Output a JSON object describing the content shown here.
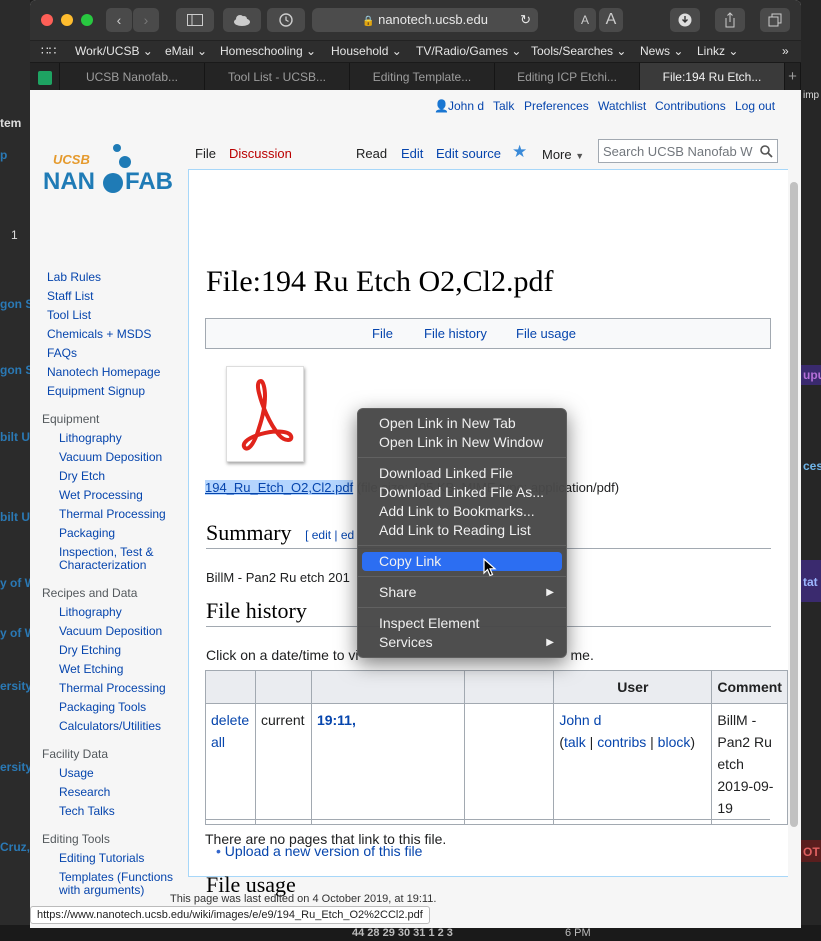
{
  "browser": {
    "url": "nanotech.ucsb.edu",
    "bookmarks": [
      "Work/UCSB",
      "eMail",
      "Homeschooling",
      "Household",
      "TV/Radio/Games",
      "Tools/Searches",
      "News",
      "Linkz"
    ],
    "tabs": [
      "UCSB Nanofab...",
      "Tool List - UCSB...",
      "Editing Template...",
      "Editing ICP Etchi...",
      "File:194 Ru Etch..."
    ],
    "status_url": "https://www.nanotech.ucsb.edu/wiki/images/e/e9/194_Ru_Etch_O2%2CCl2.pdf"
  },
  "background": {
    "left": [
      "tem",
      "p",
      "1",
      "gon S",
      "gon S",
      "bilt U",
      "bilt U",
      "y of W",
      "y of W",
      "ersity",
      "ersity",
      "Cruz,"
    ],
    "right": [
      "imp",
      "upu",
      "ces",
      "tat",
      "OT"
    ],
    "bottom_text": "44 28 29 30 31 1 2 3",
    "bottom_time": "6 PM"
  },
  "wiki": {
    "logo_top": "UCSB",
    "logo_main_1": "NAN",
    "logo_main_2": "FAB",
    "personal": {
      "user": "John d",
      "talk": "Talk",
      "preferences": "Preferences",
      "watchlist": "Watchlist",
      "contributions": "Contributions",
      "logout": "Log out"
    },
    "sidebar": {
      "main": [
        "Lab Rules",
        "Staff List",
        "Tool List",
        "Chemicals + MSDS",
        "FAQs",
        "Nanotech Homepage",
        "Equipment Signup"
      ],
      "equipment_head": "Equipment",
      "equipment": [
        "Lithography",
        "Vacuum Deposition",
        "Dry Etch",
        "Wet Processing",
        "Thermal Processing",
        "Packaging",
        "Inspection, Test & Characterization"
      ],
      "recipes_head": "Recipes and Data",
      "recipes": [
        "Lithography",
        "Vacuum Deposition",
        "Dry Etching",
        "Wet Etching",
        "Thermal Processing",
        "Packaging Tools",
        "Calculators/Utilities"
      ],
      "facility_head": "Facility Data",
      "facility": [
        "Usage",
        "Research",
        "Tech Talks"
      ],
      "editing_head": "Editing Tools",
      "editing": [
        "Editing Tutorials",
        "Templates (Functions with arguments)"
      ]
    },
    "tabs": {
      "file": "File",
      "discussion": "Discussion",
      "read": "Read",
      "edit": "Edit",
      "edit_source": "Edit source",
      "more": "More",
      "search_placeholder": "Search UCSB Nanofab W"
    },
    "title": "File:194 Ru Etch O2,Cl2.pdf",
    "filetoc": [
      "File",
      "File history",
      "File usage"
    ],
    "file_link": "194_Ru_Etch_O2,Cl2.pdf",
    "file_info": "(file size: 405 KB, MIME type: application/pdf)",
    "summary_heading": "Summary",
    "edit_bracket": "[ edit | ed",
    "summary_text": "BillM - Pan2 Ru etch 201",
    "history_heading": "File history",
    "history_intro_a": "Click on a date/time to vi",
    "history_intro_b": "me.",
    "history_table": {
      "headers": [
        "",
        "",
        "",
        "",
        "User",
        "Comment"
      ],
      "row": {
        "action_1": "delete",
        "action_2": "all",
        "status": "current",
        "datetime": "19:11,",
        "user": "John d",
        "talk": "talk",
        "contribs": "contribs",
        "block": "block",
        "comment_lines": [
          "BillM -",
          "Pan2 Ru",
          "etch",
          "2019-09-",
          "19"
        ]
      }
    },
    "upload_link": "Upload a new version of this file",
    "usage_heading": "File usage",
    "usage_text": "There are no pages that link to this file.",
    "footer": "This page was last edited on 4 October 2019, at 19:11."
  },
  "context_menu": {
    "items": [
      {
        "label": "Open Link in New Tab"
      },
      {
        "label": "Open Link in New Window"
      },
      {
        "label": "Download Linked File"
      },
      {
        "label": "Download Linked File As..."
      },
      {
        "label": "Add Link to Bookmarks..."
      },
      {
        "label": "Add Link to Reading List"
      },
      {
        "label": "Copy Link",
        "highlighted": true
      },
      {
        "label": "Share",
        "submenu": true
      },
      {
        "label": "Inspect Element"
      },
      {
        "label": "Services",
        "submenu": true
      }
    ]
  },
  "colors": {
    "accent": "#2c6ef2",
    "link": "#0645ad",
    "logo_blue": "#1f7bb6",
    "logo_orange": "#e59a2d"
  }
}
